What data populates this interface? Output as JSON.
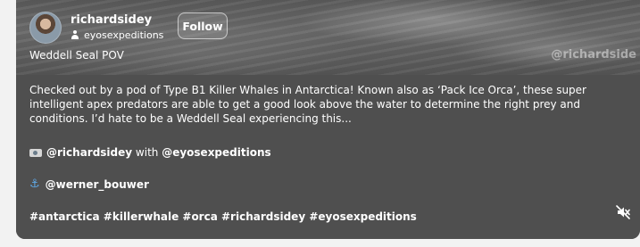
{
  "post": {
    "username": "richardsidey",
    "collaborator": "eyosexpeditions",
    "follow_label": "Follow",
    "video_title": "Weddell Seal POV",
    "watermark": "@richardside",
    "caption": "Checked out by a pod of Type B1 Killer Whales in Antarctica! Known also as ‘Pack Ice Orca’, these super intelligent apex predators are able to get a good look above the water to determine the right prey and conditions. I’d hate to be a Weddell Seal experiencing this...",
    "credit_user": "@richardsidey",
    "credit_with": " with ",
    "credit_partner": "@eyosexpeditions",
    "anchor_user": "@werner_bouwer",
    "hashtags": "#antarctica #killerwhale #orca #richardsidey #eyosexpeditions"
  },
  "icons": {
    "collaborator": "person-icon",
    "camera": "camera-icon",
    "anchor": "anchor-icon",
    "mute": "volume-muted-icon"
  },
  "colors": {
    "panel": "#4f4f4f",
    "page": "#f2f2f2",
    "anchor": "#5fa8e6"
  }
}
